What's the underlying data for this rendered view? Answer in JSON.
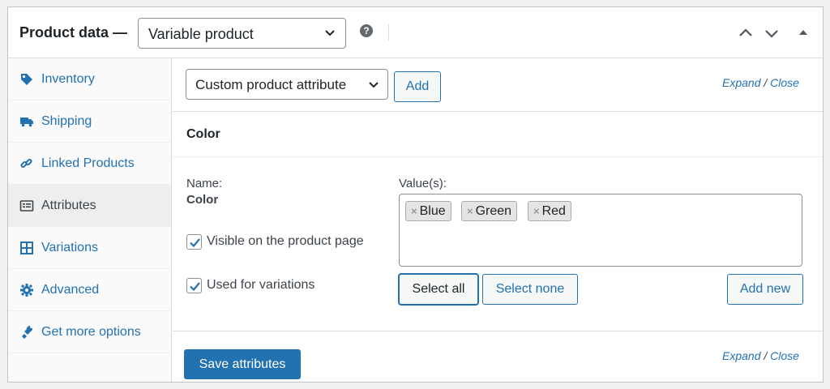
{
  "header": {
    "title": "Product data —",
    "product_type": "Variable product",
    "help": "?"
  },
  "sidebar": {
    "items": [
      {
        "label": "Inventory",
        "icon": "tag-icon"
      },
      {
        "label": "Shipping",
        "icon": "truck-icon"
      },
      {
        "label": "Linked Products",
        "icon": "link-icon"
      },
      {
        "label": "Attributes",
        "icon": "list-icon",
        "active": true
      },
      {
        "label": "Variations",
        "icon": "grid-icon"
      },
      {
        "label": "Advanced",
        "icon": "gear-icon"
      },
      {
        "label": "Get more options",
        "icon": "plugin-icon"
      }
    ]
  },
  "toolbar": {
    "attribute_select": "Custom product attribute",
    "add_label": "Add",
    "expand": "Expand",
    "slash": " / ",
    "close": "Close"
  },
  "attribute": {
    "title": "Color",
    "name_label": "Name:",
    "name_value": "Color",
    "visible_label": "Visible on the product page",
    "visible_checked": true,
    "variations_label": "Used for variations",
    "variations_checked": true,
    "values_label": "Value(s):",
    "values": [
      "Blue",
      "Green",
      "Red"
    ],
    "remove_glyph": "×",
    "select_all": "Select all",
    "select_none": "Select none",
    "add_new": "Add new"
  },
  "footer": {
    "save_label": "Save attributes",
    "expand": "Expand",
    "slash": " / ",
    "close": "Close"
  },
  "colors": {
    "accent": "#2271b1",
    "text": "#1d2327",
    "border": "#c3c4c7"
  }
}
